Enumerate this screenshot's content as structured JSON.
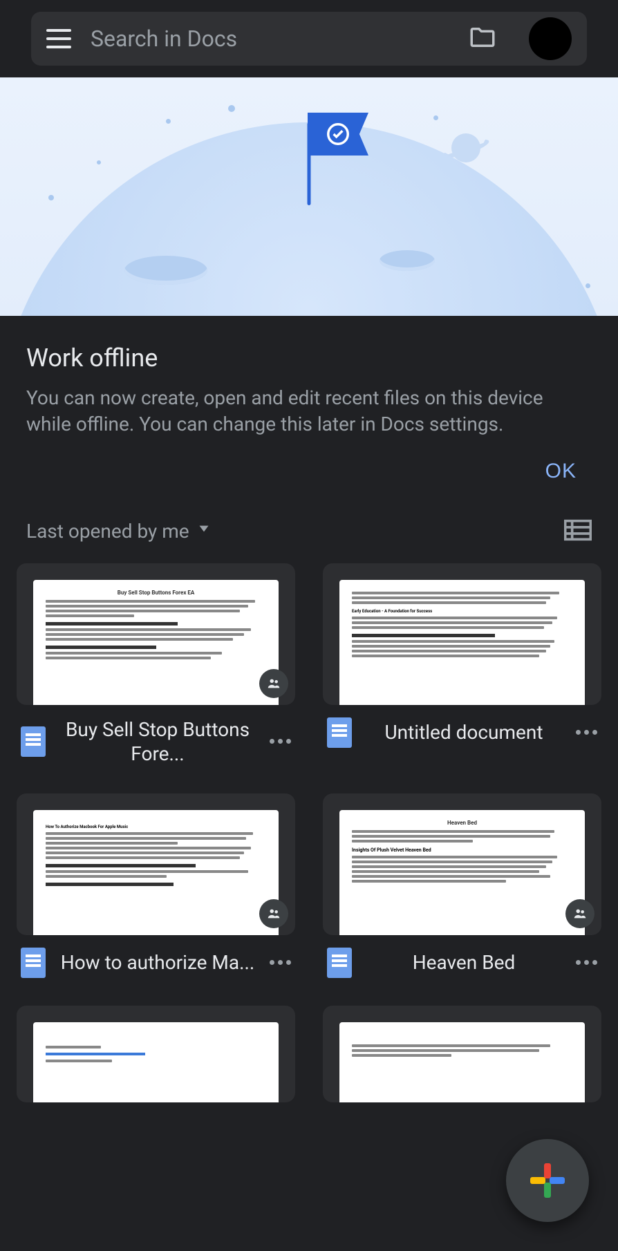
{
  "search": {
    "placeholder": "Search in Docs"
  },
  "message": {
    "title": "Work offline",
    "body": "You can now create, open and edit recent files on this device while offline. You can change this later in Docs settings.",
    "ok_label": "OK"
  },
  "sort": {
    "label": "Last opened by me"
  },
  "documents": [
    {
      "title": "Buy Sell Stop Buttons Fore...",
      "shared": true,
      "preview_heading": "Buy Sell Stop Buttons Forex EA"
    },
    {
      "title": "Untitled document",
      "shared": false,
      "preview_heading": "Early Education - A Foundation for Success"
    },
    {
      "title": "How to authorize Ma...",
      "shared": true,
      "preview_heading": "How To Authorize Macbook For Apple Music"
    },
    {
      "title": "Heaven Bed",
      "shared": true,
      "preview_heading": "Insights Of Plush Velvet Heaven Bed"
    },
    {
      "title": "",
      "shared": false,
      "preview_heading": ""
    },
    {
      "title": "",
      "shared": false,
      "preview_heading": ""
    }
  ]
}
